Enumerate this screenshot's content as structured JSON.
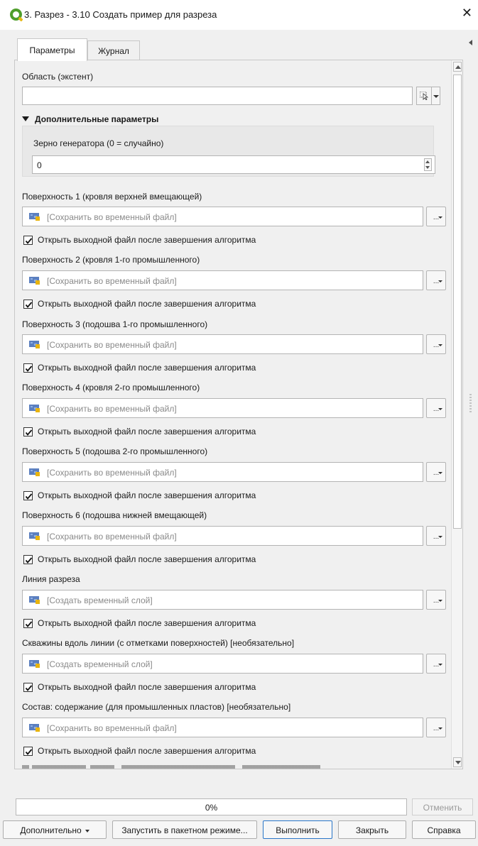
{
  "window": {
    "title": "3. Разрез - 3.10 Создать пример для разреза",
    "close_symbol": "✕"
  },
  "tabs": [
    {
      "label": "Параметры",
      "active": true
    },
    {
      "label": "Журнал",
      "active": false
    }
  ],
  "extent": {
    "label": "Область (экстент)",
    "value": ""
  },
  "advanced": {
    "header": "Дополнительные параметры",
    "seed_label": "Зерно генератора (0 = случайно)",
    "seed_value": "0"
  },
  "outputs": [
    {
      "label": "Поверхность 1 (кровля верхней вмещающей)",
      "placeholder": "[Сохранить во временный файл]",
      "open_after": "Открыть выходной файл после завершения алгоритма",
      "checked": true
    },
    {
      "label": "Поверхность 2 (кровля 1-го промышленного)",
      "placeholder": "[Сохранить во временный файл]",
      "open_after": "Открыть выходной файл после завершения алгоритма",
      "checked": true
    },
    {
      "label": "Поверхность 3 (подошва 1-го промышленного)",
      "placeholder": "[Сохранить во временный файл]",
      "open_after": "Открыть выходной файл после завершения алгоритма",
      "checked": true
    },
    {
      "label": "Поверхность 4 (кровля 2-го промышленного)",
      "placeholder": "[Сохранить во временный файл]",
      "open_after": "Открыть выходной файл после завершения алгоритма",
      "checked": true
    },
    {
      "label": "Поверхность 5 (подошва 2-го промышленного)",
      "placeholder": "[Сохранить во временный файл]",
      "open_after": "Открыть выходной файл после завершения алгоритма",
      "checked": true
    },
    {
      "label": "Поверхность 6 (подошва нижней вмещающей)",
      "placeholder": "[Сохранить во временный файл]",
      "open_after": "Открыть выходной файл после завершения алгоритма",
      "checked": true
    },
    {
      "label": "Линия разреза",
      "placeholder": "[Создать временный слой]",
      "open_after": "Открыть выходной файл после завершения алгоритма",
      "checked": true
    },
    {
      "label": "Скважины вдоль линии (с отметками поверхностей) [необязательно]",
      "placeholder": "[Создать временный слой]",
      "open_after": "Открыть выходной файл после завершения алгоритма",
      "checked": true
    },
    {
      "label": "Состав: содержание (для промышленных пластов) [необязательно]",
      "placeholder": "[Сохранить во временный файл]",
      "open_after": "Открыть выходной файл после завершения алгоритма",
      "checked": true
    }
  ],
  "dots_label": "...",
  "progress": {
    "text": "0%",
    "value": 0,
    "cancel_label": "Отменить"
  },
  "buttons": {
    "advanced": "Дополнительно",
    "batch": "Запустить в пакетном режиме...",
    "run": "Выполнить",
    "close": "Закрыть",
    "help": "Справка"
  },
  "colors": {
    "qgis_green": "#4f9e2c",
    "primary_border": "#2a76c8",
    "layer_icon": "#5b7fbf"
  }
}
